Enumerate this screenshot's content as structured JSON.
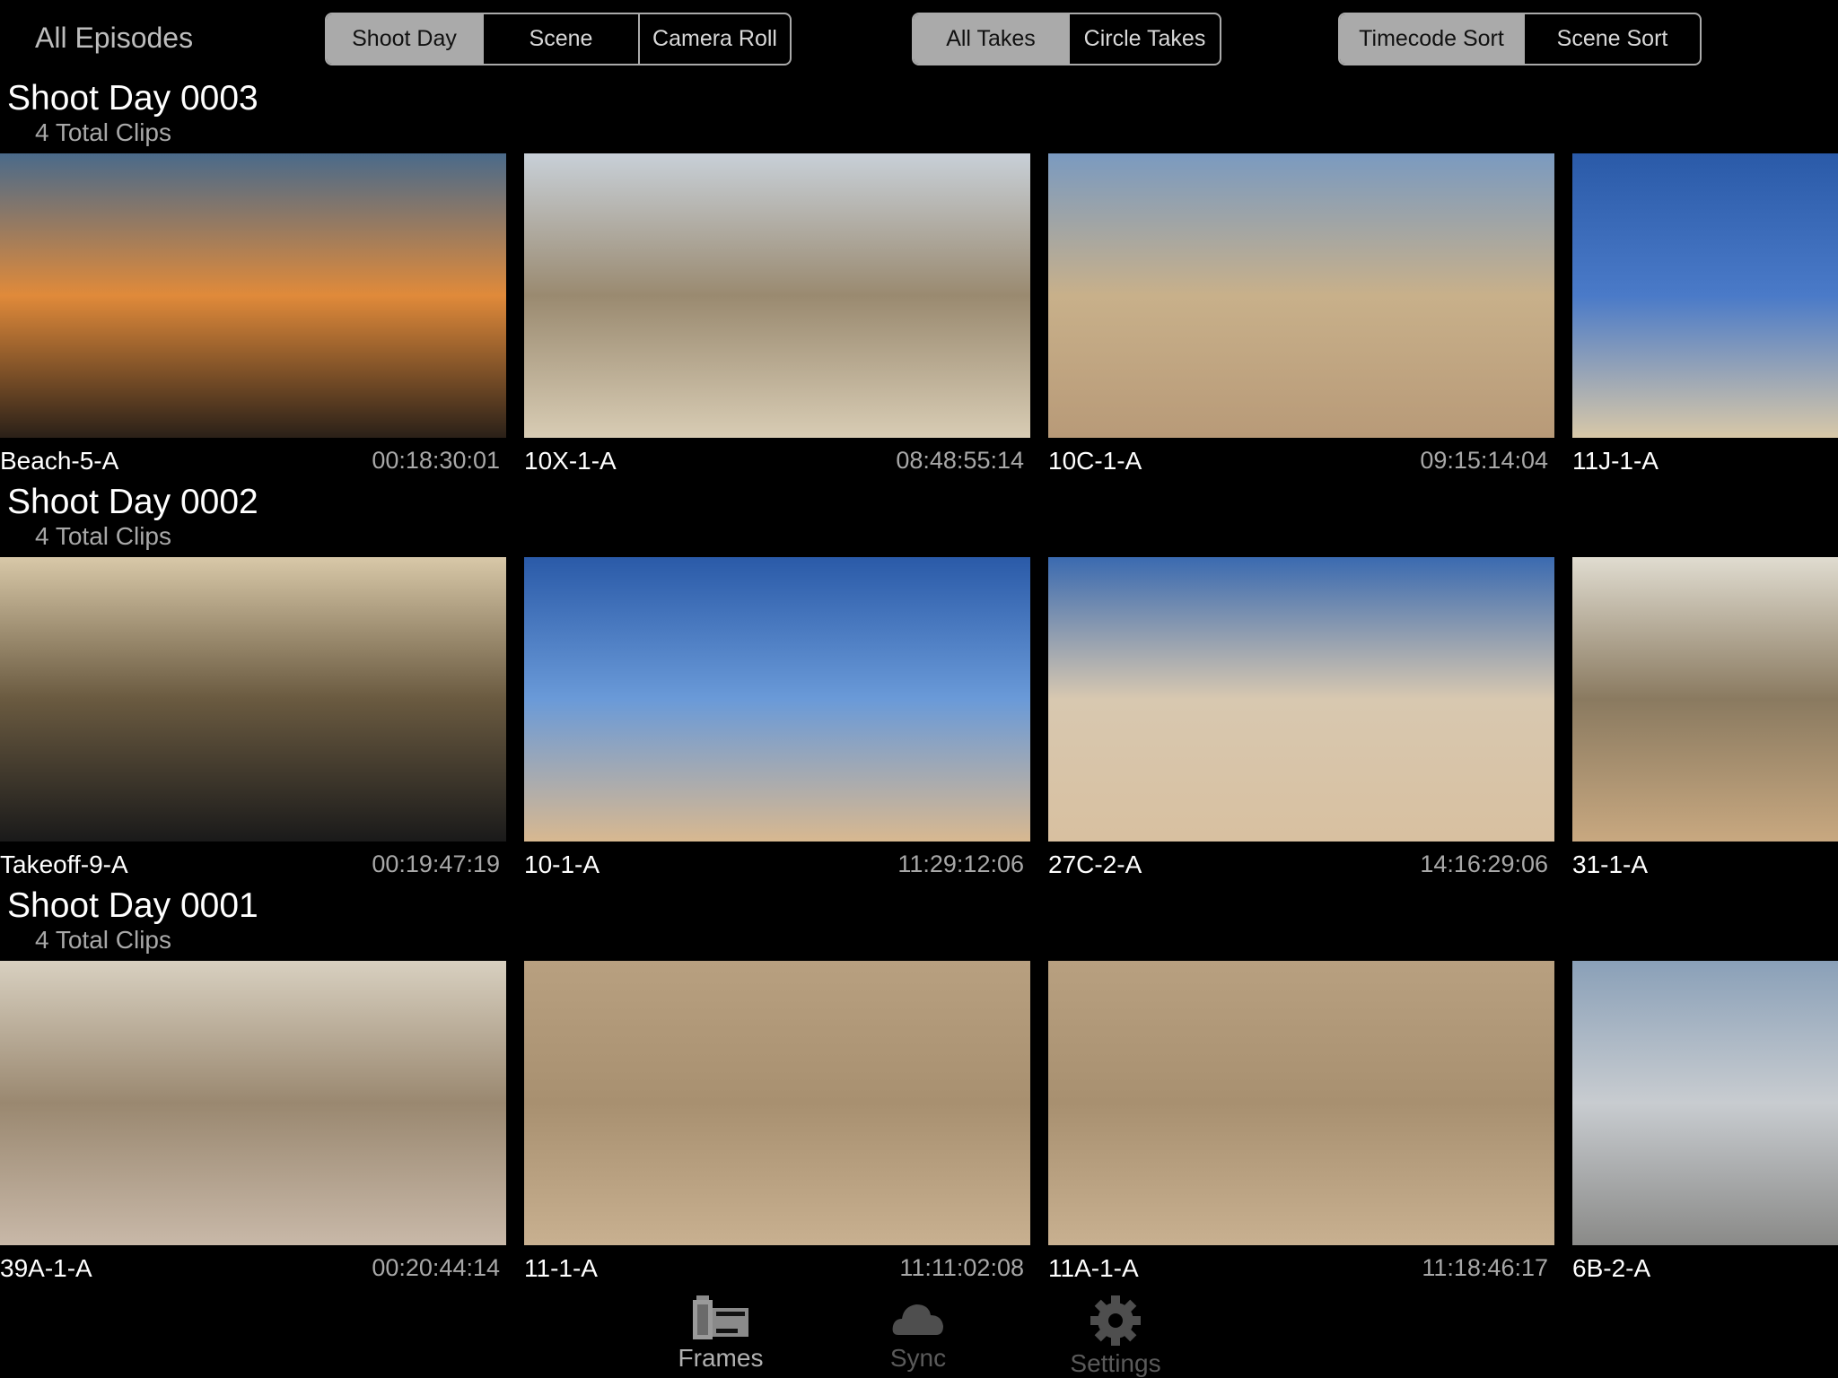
{
  "header": {
    "title": "All Episodes",
    "group_by": {
      "options": [
        "Shoot Day",
        "Scene",
        "Camera Roll"
      ],
      "selected": "Shoot Day"
    },
    "take_filter": {
      "options": [
        "All Takes",
        "Circle Takes"
      ],
      "selected": "All Takes"
    },
    "sort": {
      "options": [
        "Timecode Sort",
        "Scene Sort"
      ],
      "selected": "Timecode Sort"
    }
  },
  "sections": [
    {
      "title": "Shoot Day 0003",
      "subtitle": "4 Total Clips",
      "clips": [
        {
          "name": "Beach-5-A",
          "timecode": "00:18:30:01",
          "colors": [
            "#4a6a8a",
            "#e08a3a",
            "#2a2018"
          ]
        },
        {
          "name": "10X-1-A",
          "timecode": "08:48:55:14",
          "colors": [
            "#c8d0d8",
            "#9a8a70",
            "#d8ccb4"
          ]
        },
        {
          "name": "10C-1-A",
          "timecode": "09:15:14:04",
          "colors": [
            "#7a9ac0",
            "#c8b08a",
            "#b89a78"
          ]
        },
        {
          "name": "11J-1-A",
          "timecode": "",
          "colors": [
            "#2a5aa8",
            "#4a7ac8",
            "#d8c8a8"
          ]
        }
      ]
    },
    {
      "title": "Shoot Day 0002",
      "subtitle": "4 Total Clips",
      "clips": [
        {
          "name": "Takeoff-9-A",
          "timecode": "00:19:47:19",
          "colors": [
            "#d8c8a8",
            "#6a5a40",
            "#1a1a1a"
          ]
        },
        {
          "name": "10-1-A",
          "timecode": "11:29:12:06",
          "colors": [
            "#2a5aa8",
            "#6a9ad8",
            "#d8b890"
          ]
        },
        {
          "name": "27C-2-A",
          "timecode": "14:16:29:06",
          "colors": [
            "#3a6ab0",
            "#d8c8b0",
            "#d8c0a0"
          ]
        },
        {
          "name": "31-1-A",
          "timecode": "",
          "colors": [
            "#e0dcd0",
            "#8a7a60",
            "#c8a880"
          ]
        }
      ]
    },
    {
      "title": "Shoot Day 0001",
      "subtitle": "4 Total Clips",
      "clips": [
        {
          "name": "39A-1-A",
          "timecode": "00:20:44:14",
          "colors": [
            "#d8d0c0",
            "#9a8870",
            "#c8b8a8"
          ]
        },
        {
          "name": "11-1-A",
          "timecode": "11:11:02:08",
          "colors": [
            "#b8a080",
            "#a89070",
            "#c8b090"
          ]
        },
        {
          "name": "11A-1-A",
          "timecode": "11:18:46:17",
          "colors": [
            "#b8a080",
            "#a89070",
            "#c8b090"
          ]
        },
        {
          "name": "6B-2-A",
          "timecode": "",
          "colors": [
            "#8aa0b8",
            "#c8ccd0",
            "#8a8a88"
          ]
        }
      ]
    }
  ],
  "tabs": [
    {
      "label": "Frames",
      "icon": "film-icon",
      "active": true
    },
    {
      "label": "Sync",
      "icon": "cloud-icon",
      "active": false
    },
    {
      "label": "Settings",
      "icon": "gear-icon",
      "active": false
    }
  ]
}
